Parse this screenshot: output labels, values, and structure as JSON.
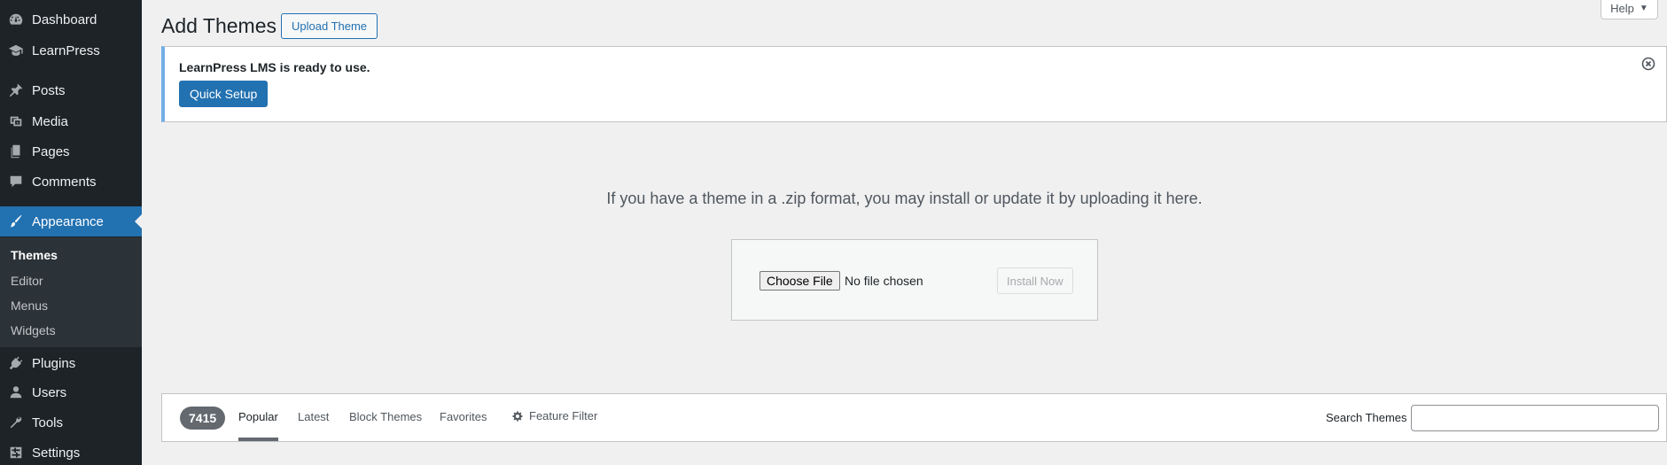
{
  "sidebar": {
    "items": [
      {
        "label": "Dashboard",
        "icon": "dashboard-icon"
      },
      {
        "label": "LearnPress",
        "icon": "graduation-cap-icon"
      },
      {
        "label": "Posts",
        "icon": "pin-icon"
      },
      {
        "label": "Media",
        "icon": "media-icon"
      },
      {
        "label": "Pages",
        "icon": "pages-icon"
      },
      {
        "label": "Comments",
        "icon": "comments-icon"
      },
      {
        "label": "Appearance",
        "icon": "brush-icon",
        "active": true
      },
      {
        "label": "Plugins",
        "icon": "plug-icon"
      },
      {
        "label": "Users",
        "icon": "user-icon"
      },
      {
        "label": "Tools",
        "icon": "wrench-icon"
      },
      {
        "label": "Settings",
        "icon": "settings-icon"
      }
    ],
    "submenu": [
      {
        "label": "Themes",
        "current": true
      },
      {
        "label": "Editor"
      },
      {
        "label": "Menus"
      },
      {
        "label": "Widgets"
      }
    ]
  },
  "header": {
    "title": "Add Themes",
    "upload_label": "Upload Theme",
    "help_label": "Help"
  },
  "notice": {
    "text": "LearnPress LMS is ready to use.",
    "button_label": "Quick Setup"
  },
  "upload": {
    "help_text": "If you have a theme in a .zip format, you may install or update it by uploading it here.",
    "choose_label": "Choose File",
    "no_file_text": "No file chosen",
    "install_label": "Install Now"
  },
  "filter": {
    "count": "7415",
    "links": [
      "Popular",
      "Latest",
      "Block Themes",
      "Favorites"
    ],
    "feature_label": "Feature Filter",
    "search_label": "Search Themes",
    "search_value": ""
  },
  "colors": {
    "sidebar_bg": "#1d2327",
    "accent": "#2271b1",
    "notice_border": "#72aee6"
  }
}
